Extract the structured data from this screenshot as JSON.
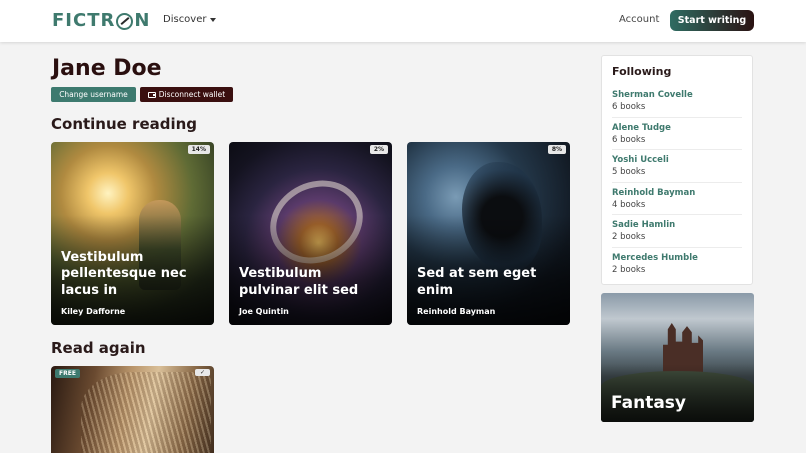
{
  "header": {
    "logo": "FICTRON",
    "discover_label": "Discover",
    "account_label": "Account",
    "start_writing_label": "Start writing"
  },
  "profile": {
    "name": "Jane Doe",
    "change_username_label": "Change username",
    "disconnect_wallet_label": "Disconnect wallet"
  },
  "continue_reading": {
    "title": "Continue reading",
    "books": [
      {
        "title": "Vestibulum pellentesque nec lacus in",
        "author": "Kiley Dafforne",
        "progress": "14%"
      },
      {
        "title": "Vestibulum pulvinar elit sed",
        "author": "Joe Quintin",
        "progress": "2%"
      },
      {
        "title": "Sed at sem eget enim",
        "author": "Reinhold Bayman",
        "progress": "8%"
      }
    ]
  },
  "read_again": {
    "title": "Read again",
    "books": [
      {
        "badge": "FREE",
        "status": "✓"
      }
    ]
  },
  "following": {
    "title": "Following",
    "authors": [
      {
        "name": "Sherman Covelle",
        "count": "6 books"
      },
      {
        "name": "Alene Tudge",
        "count": "6 books"
      },
      {
        "name": "Yoshi Ucceli",
        "count": "5 books"
      },
      {
        "name": "Reinhold Bayman",
        "count": "4 books"
      },
      {
        "name": "Sadie Hamlin",
        "count": "2 books"
      },
      {
        "name": "Mercedes Humble",
        "count": "2 books"
      }
    ]
  },
  "genre": {
    "label": "Fantasy"
  },
  "colors": {
    "brand": "#3f7a6e",
    "dark_accent": "#3a0f0f"
  }
}
